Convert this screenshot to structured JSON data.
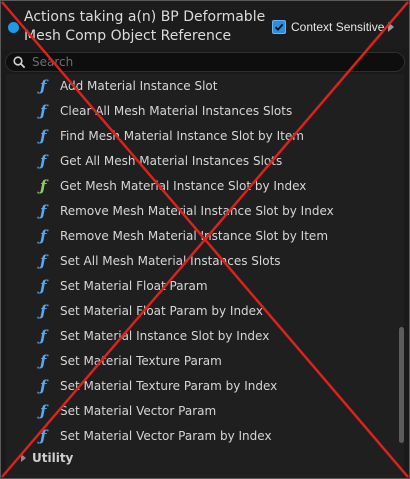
{
  "header": {
    "title_line1": "Actions taking a(n) BP Deformable",
    "title_line2": "Mesh Comp Object Reference",
    "context_sensitive_label": "Context Sensitive",
    "context_sensitive_checked": true,
    "pin_color": "#1f9be6"
  },
  "search": {
    "placeholder": "Search",
    "value": ""
  },
  "list": {
    "items": [
      {
        "label": "Add Material Instance Slot",
        "icon": "function-icon"
      },
      {
        "label": "Clear All Mesh Material Instances Slots",
        "icon": "function-icon"
      },
      {
        "label": "Find Mesh Material Instance Slot by Item",
        "icon": "function-icon"
      },
      {
        "label": "Get All Mesh Material Instances Slots",
        "icon": "function-icon"
      },
      {
        "label": "Get Mesh Material Instance Slot by Index",
        "icon": "pure-function-icon"
      },
      {
        "label": "Remove Mesh Material Instance Slot by Index",
        "icon": "function-icon"
      },
      {
        "label": "Remove Mesh Material Instance Slot by Item",
        "icon": "function-icon"
      },
      {
        "label": "Set All Mesh Material Instances Slots",
        "icon": "function-icon"
      },
      {
        "label": "Set Material Float Param",
        "icon": "function-icon"
      },
      {
        "label": "Set Material Float Param by Index",
        "icon": "function-icon"
      },
      {
        "label": "Set Material Instance Slot by Index",
        "icon": "function-icon"
      },
      {
        "label": "Set Material Texture Param",
        "icon": "function-icon"
      },
      {
        "label": "Set Material Texture Param by Index",
        "icon": "function-icon"
      },
      {
        "label": "Set Material Vector Param",
        "icon": "function-icon"
      },
      {
        "label": "Set Material Vector Param by Index",
        "icon": "function-icon"
      }
    ],
    "category": {
      "label": "Utility",
      "expanded": false
    }
  },
  "overlay": {
    "cross_color": "#d9231f"
  }
}
